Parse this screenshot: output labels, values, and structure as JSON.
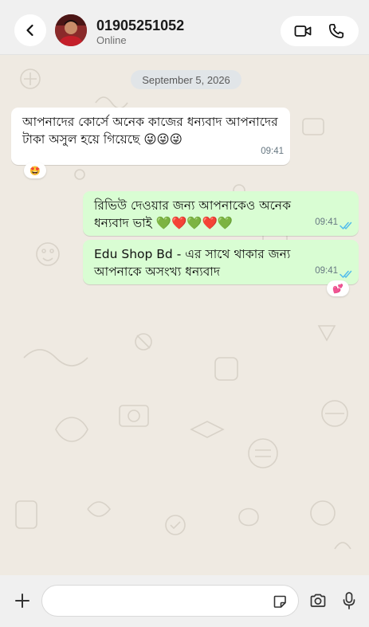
{
  "header": {
    "contact_name": "01905251052",
    "status": "Online"
  },
  "chat": {
    "date_chip": "September 5, 2026",
    "messages": [
      {
        "direction": "incoming",
        "text": "আপনাদের কোর্সে অনেক কাজের ধন্যবাদ আপনাদের টাকা অসুল হয়ে গিয়েছে 😜😜😜",
        "time": "09:41",
        "reaction": "🤩"
      },
      {
        "direction": "outgoing",
        "text": "রিভিউ দেওয়ার জন্য আপনাকেও অনেক ধন্যবাদ ভাই 💚❤️💚❤️💚",
        "time": "09:41",
        "status": "read"
      },
      {
        "direction": "outgoing",
        "text": "Edu Shop Bd - এর সাথে থাকার জন্য আপনাকে অসংখ্য ধন্যবাদ",
        "time": "09:41",
        "status": "read",
        "reaction": "💕"
      }
    ]
  },
  "composer": {
    "placeholder": "",
    "value": ""
  },
  "icons": {
    "back": "chevron-left-icon",
    "video": "video-camera-icon",
    "phone": "phone-icon",
    "plus": "plus-icon",
    "sticker": "sticker-icon",
    "camera": "camera-icon",
    "mic": "microphone-icon"
  },
  "colors": {
    "chat_background": "#efeae2",
    "outgoing_bubble": "#d9fdd3",
    "incoming_bubble": "#ffffff",
    "read_ticks": "#53bdeb"
  }
}
